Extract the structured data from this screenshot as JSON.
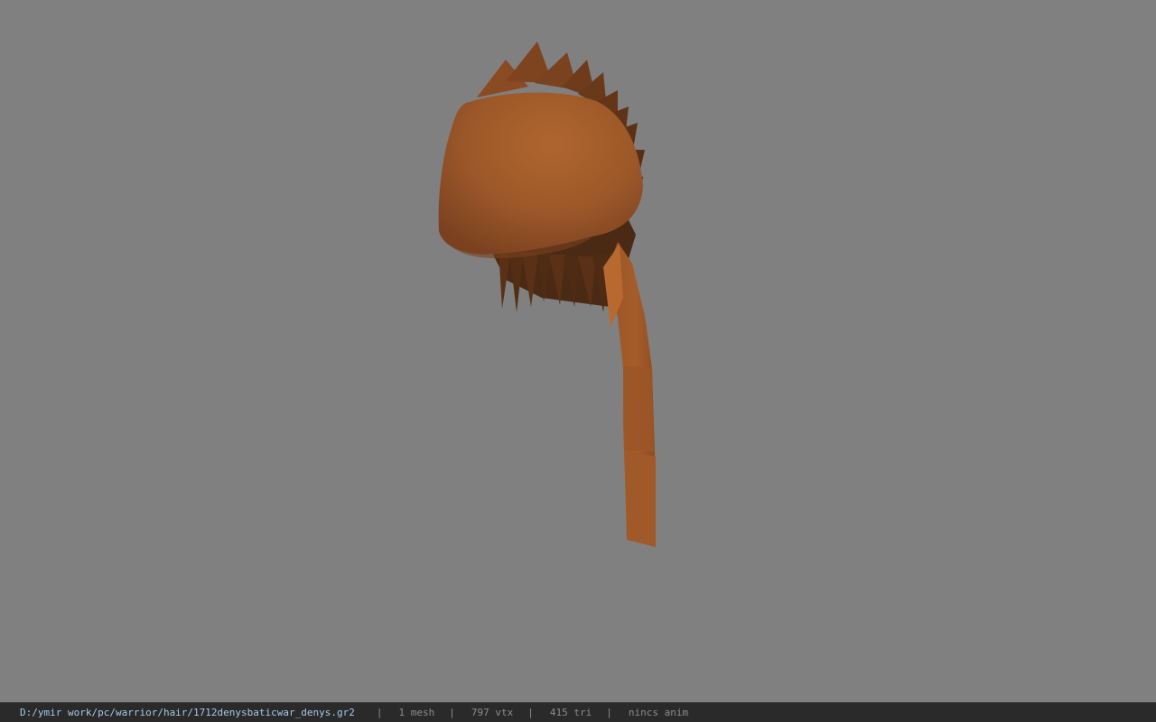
{
  "viewport": {
    "background": "#808080",
    "model_color": "#a55e2e",
    "model_shadow": "#4a2a14"
  },
  "statusbar": {
    "file_path": "D:/ymir work/pc/warrior/hair/1712denysbaticwar_denys.gr2",
    "separator": "|",
    "mesh_count": "1 mesh",
    "vertex_count": "797 vtx",
    "triangle_count": "415 tri",
    "anim_status": "nincs anim"
  }
}
